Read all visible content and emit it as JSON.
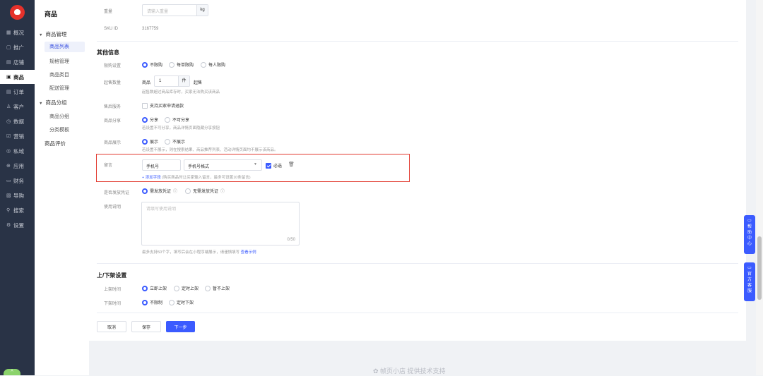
{
  "sidebar": {
    "items": [
      {
        "icon": "▦",
        "label": "概况"
      },
      {
        "icon": "▢",
        "label": "推广"
      },
      {
        "icon": "▤",
        "label": "店铺"
      },
      {
        "icon": "▣",
        "label": "商品"
      },
      {
        "icon": "▤",
        "label": "订单"
      },
      {
        "icon": "♙",
        "label": "客户"
      },
      {
        "icon": "◷",
        "label": "数据"
      },
      {
        "icon": "☑",
        "label": "营销"
      },
      {
        "icon": "◎",
        "label": "私域"
      },
      {
        "icon": "⊕",
        "label": "应用"
      },
      {
        "icon": "▭",
        "label": "财务"
      },
      {
        "icon": "▧",
        "label": "导购"
      },
      {
        "icon": "⚲",
        "label": "搜索"
      },
      {
        "icon": "⚙",
        "label": "设置"
      }
    ],
    "collapse_icon": "^"
  },
  "subnav": {
    "title": "商品",
    "group1": "商品管理",
    "items1": [
      "商品列表",
      "规格管理",
      "商品类目",
      "配送管理"
    ],
    "group2": "商品分组",
    "items2": [
      "商品分组",
      "分类模板"
    ],
    "group3": "商品评价"
  },
  "form": {
    "weight": {
      "label": "重量",
      "placeholder": "请输入重量",
      "unit": "kg"
    },
    "sku": {
      "label": "SKU ID",
      "value": "3167759"
    },
    "other_title": "其他信息",
    "purchase_limit": {
      "label": "限购设置",
      "options": [
        "不限购",
        "每单限购",
        "每人限购"
      ]
    },
    "min_qty": {
      "label": "起售数量",
      "prefix": "商品",
      "value": "1",
      "unit": "件",
      "suffix": "起售",
      "hint": "起售数超过商品库存时，买家无法购买该商品"
    },
    "after_sale": {
      "label": "售后服务",
      "option": "支持买家申请退款"
    },
    "share": {
      "label": "商品分享",
      "options": [
        "分享",
        "不可分享"
      ],
      "hint": "若设置不可分享，商品详情页面隐藏分享按钮"
    },
    "display": {
      "label": "商品展示",
      "options": [
        "展示",
        "不展示"
      ],
      "hint": "若设置不展示，则在搜索结果、商品推荐列表、活动详情页面均不展示该商品。"
    },
    "message": {
      "label": "留言",
      "field": "手机号",
      "type": "手机号格式",
      "required": "必选",
      "add": "+ 添加字段",
      "add_hint": "(购买商品时让买家输入留言，最多可设置10条留言)"
    },
    "voucher": {
      "label": "是否发放凭证",
      "options": [
        "需发放凭证",
        "无需发放凭证"
      ]
    },
    "usage": {
      "label": "使用说明",
      "placeholder": "请填写使用说明",
      "count": "0/50",
      "hint": "最多支持50个字，填写后会在小程序端展示，请谨慎填写",
      "link": "查看示例"
    },
    "shelf_title": "上/下架设置",
    "on_shelf": {
      "label": "上架时间",
      "options": [
        "立即上架",
        "定时上架",
        "暂不上架"
      ]
    },
    "off_shelf": {
      "label": "下架时间",
      "options": [
        "不限制",
        "定时下架"
      ]
    },
    "buttons": {
      "cancel": "取消",
      "save": "保存",
      "next": "下一步"
    }
  },
  "float_buttons": [
    {
      "label": "帮助中心",
      "chars": [
        "帮",
        "助",
        "中",
        "心"
      ]
    },
    {
      "label": "官方客服",
      "chars": [
        "官",
        "方",
        "客",
        "服"
      ]
    }
  ],
  "footer": "✿ 帧页小店 提供技术支持",
  "colors": {
    "primary": "#3b5bff",
    "sidebar": "#293346",
    "highlight": "#e23b30"
  }
}
